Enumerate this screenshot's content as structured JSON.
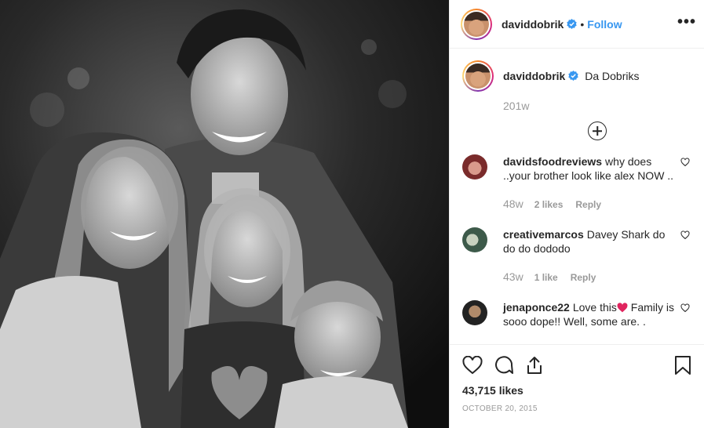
{
  "post": {
    "username": "daviddobrik",
    "follow_label": "Follow",
    "dot": "•",
    "more_label": "•••"
  },
  "caption": {
    "username": "daviddobrik",
    "text": "Da Dobriks",
    "time": "201w"
  },
  "comments": [
    {
      "username": "davidsfoodreviews",
      "text": "why does ..your brother look like alex NOW ..",
      "time": "48w",
      "likes": "2 likes",
      "reply": "Reply"
    },
    {
      "username": "creativemarcos",
      "text": "Davey Shark do do do dododo",
      "time": "43w",
      "likes": "1 like",
      "reply": "Reply"
    },
    {
      "username": "jenaponce22",
      "text_before": "Love this",
      "text_after": " Family is sooo dope!! Well, some are. .",
      "time": "",
      "likes": "",
      "reply": ""
    }
  ],
  "actions": {
    "like_count": "43,715 likes",
    "date": "October 20, 2015"
  },
  "icons": {
    "verified": "verified-badge-icon",
    "like": "heart-icon",
    "comment": "comment-bubble-icon",
    "share": "share-icon",
    "save": "bookmark-icon",
    "load_more": "plus-circle-icon"
  },
  "colors": {
    "link": "#3897f0",
    "secondary_text": "#999999",
    "border": "#efefef",
    "verified": "#3897f0",
    "emoji_heart": "#e0245e"
  }
}
